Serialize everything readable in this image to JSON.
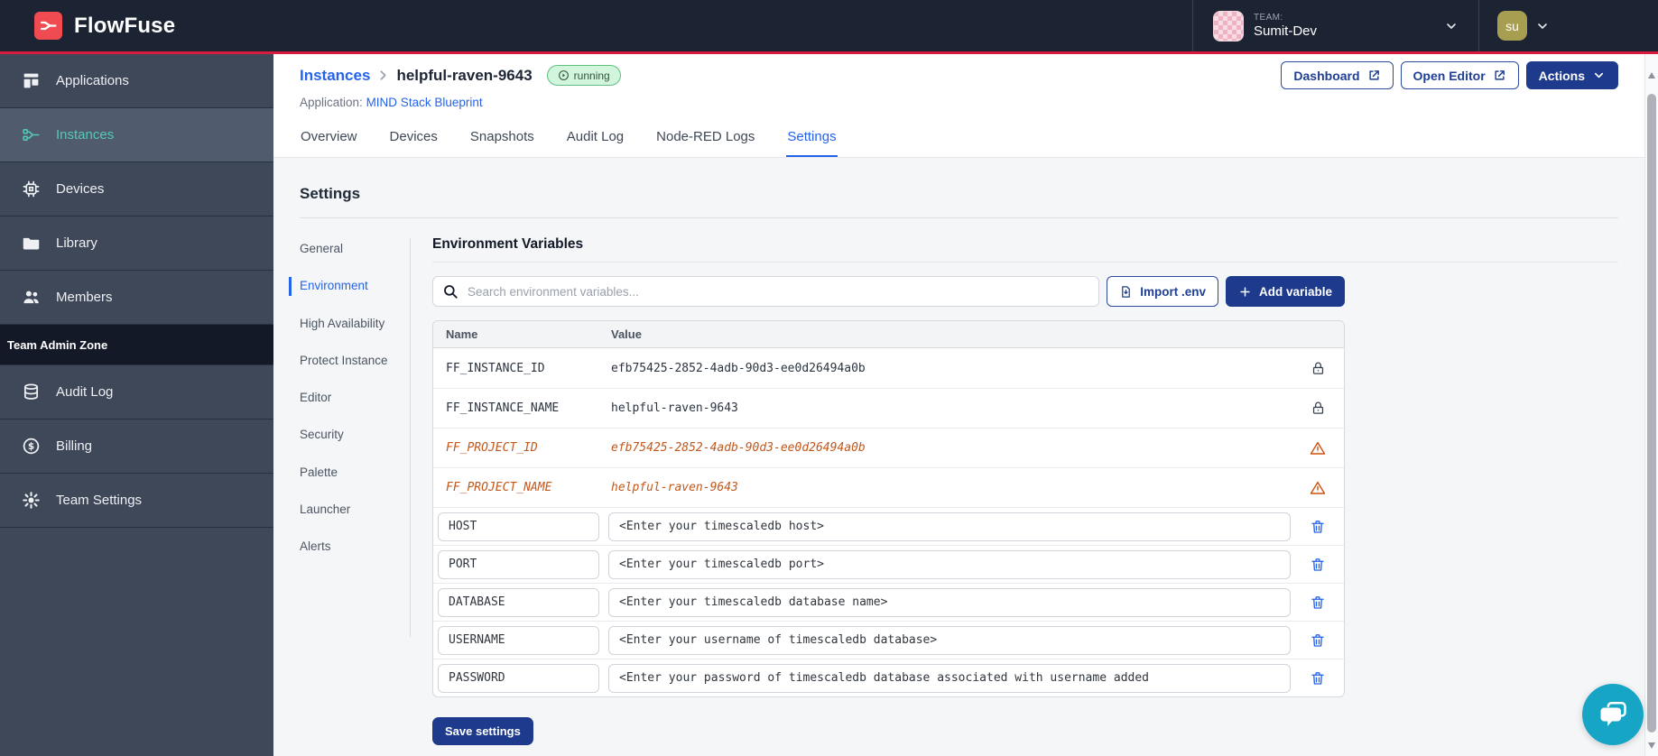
{
  "topbar": {
    "brand": "FlowFuse",
    "team_label": "TEAM:",
    "team_name": "Sumit-Dev",
    "user_initials": "su"
  },
  "sidebar": {
    "items": [
      {
        "label": "Applications"
      },
      {
        "label": "Instances"
      },
      {
        "label": "Devices"
      },
      {
        "label": "Library"
      },
      {
        "label": "Members"
      }
    ],
    "admin_zone_label": "Team Admin Zone",
    "admin_items": [
      {
        "label": "Audit Log"
      },
      {
        "label": "Billing"
      },
      {
        "label": "Team Settings"
      }
    ]
  },
  "header": {
    "breadcrumb_parent": "Instances",
    "instance_name": "helpful-raven-9643",
    "status": "running",
    "application_label": "Application:",
    "application_name": "MIND Stack Blueprint",
    "dashboard_button": "Dashboard",
    "open_editor_button": "Open Editor",
    "actions_button": "Actions"
  },
  "tabs": {
    "items": [
      {
        "label": "Overview"
      },
      {
        "label": "Devices"
      },
      {
        "label": "Snapshots"
      },
      {
        "label": "Audit Log"
      },
      {
        "label": "Node-RED Logs"
      },
      {
        "label": "Settings"
      }
    ],
    "active": "Settings"
  },
  "settings": {
    "title": "Settings",
    "nav": [
      {
        "label": "General"
      },
      {
        "label": "Environment"
      },
      {
        "label": "High Availability"
      },
      {
        "label": "Protect Instance"
      },
      {
        "label": "Editor"
      },
      {
        "label": "Security"
      },
      {
        "label": "Palette"
      },
      {
        "label": "Launcher"
      },
      {
        "label": "Alerts"
      }
    ],
    "active": "Environment"
  },
  "env": {
    "title": "Environment Variables",
    "search_placeholder": "Search environment variables...",
    "import_button": "Import .env",
    "add_button": "Add variable",
    "save_button": "Save settings",
    "columns": {
      "name": "Name",
      "value": "Value"
    },
    "locked_rows": [
      {
        "name": "FF_INSTANCE_ID",
        "value": "efb75425-2852-4adb-90d3-ee0d26494a0b"
      },
      {
        "name": "FF_INSTANCE_NAME",
        "value": "helpful-raven-9643"
      }
    ],
    "deprecated_rows": [
      {
        "name": "FF_PROJECT_ID",
        "value": "efb75425-2852-4adb-90d3-ee0d26494a0b"
      },
      {
        "name": "FF_PROJECT_NAME",
        "value": "helpful-raven-9643"
      }
    ],
    "editable_rows": [
      {
        "name": "HOST",
        "value": "<Enter your timescaledb host>"
      },
      {
        "name": "PORT",
        "value": "<Enter your timescaledb port>"
      },
      {
        "name": "DATABASE",
        "value": "<Enter your timescaledb database name>"
      },
      {
        "name": "USERNAME",
        "value": "<Enter your username of timescaledb database>"
      },
      {
        "name": "PASSWORD",
        "value": "<Enter your password of timescaledb database associated with username added"
      }
    ]
  },
  "colors": {
    "topbar_navy": "#1c2433",
    "sidebar_gray": "#3f4859",
    "accent_blue": "#2563eb",
    "primary_navy": "#1e3a8d",
    "brand_red": "#ef4b51",
    "red_line": "#d61b3d",
    "teal_active": "#57c7ba",
    "warning_orange": "#c2581c",
    "running_badge_bg": "#d2f5de",
    "running_badge_border": "#5fc07e",
    "chat_teal": "#17a5c5"
  }
}
